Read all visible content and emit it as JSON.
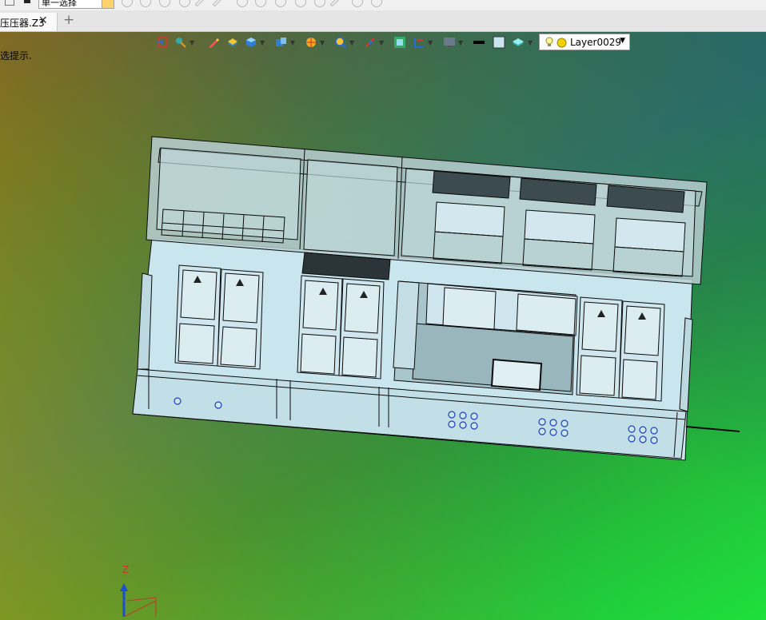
{
  "toolbar": {
    "selection_filter": "单一选择",
    "icons": [
      "pointer-icon",
      "lasso-icon",
      "circle-select-icon",
      "line-icon",
      "arc-icon",
      "rotate-icon",
      "point-icon",
      "bend-icon",
      "curve-icon",
      "surface-icon"
    ]
  },
  "tabs": [
    {
      "label": "压压器.Z3",
      "close": "✕"
    }
  ],
  "tab_add": "+",
  "viewport": {
    "hint": "选提示.",
    "float_toolbar": {
      "icons": [
        "import-icon",
        "pick-filter-icon",
        "sketch-pen-icon",
        "solid-icon",
        "cube-icon",
        "view-cube-icon",
        "render-icon",
        "zoom-icon",
        "snap-icon",
        "grid-icon",
        "section-icon",
        "display-icon",
        "line-style-icon",
        "fill-color-icon",
        "layer-manager-icon"
      ],
      "layer": "Layer0029",
      "layer_icons": [
        "lightbulb-icon",
        "sun-icon"
      ]
    },
    "triad_label": "Z"
  },
  "colors": {
    "panel_fill": "#c9e6ef",
    "panel_glass": "#b8cfd2",
    "edge": "#0a0a0a",
    "hole": "#1a3fbf"
  }
}
